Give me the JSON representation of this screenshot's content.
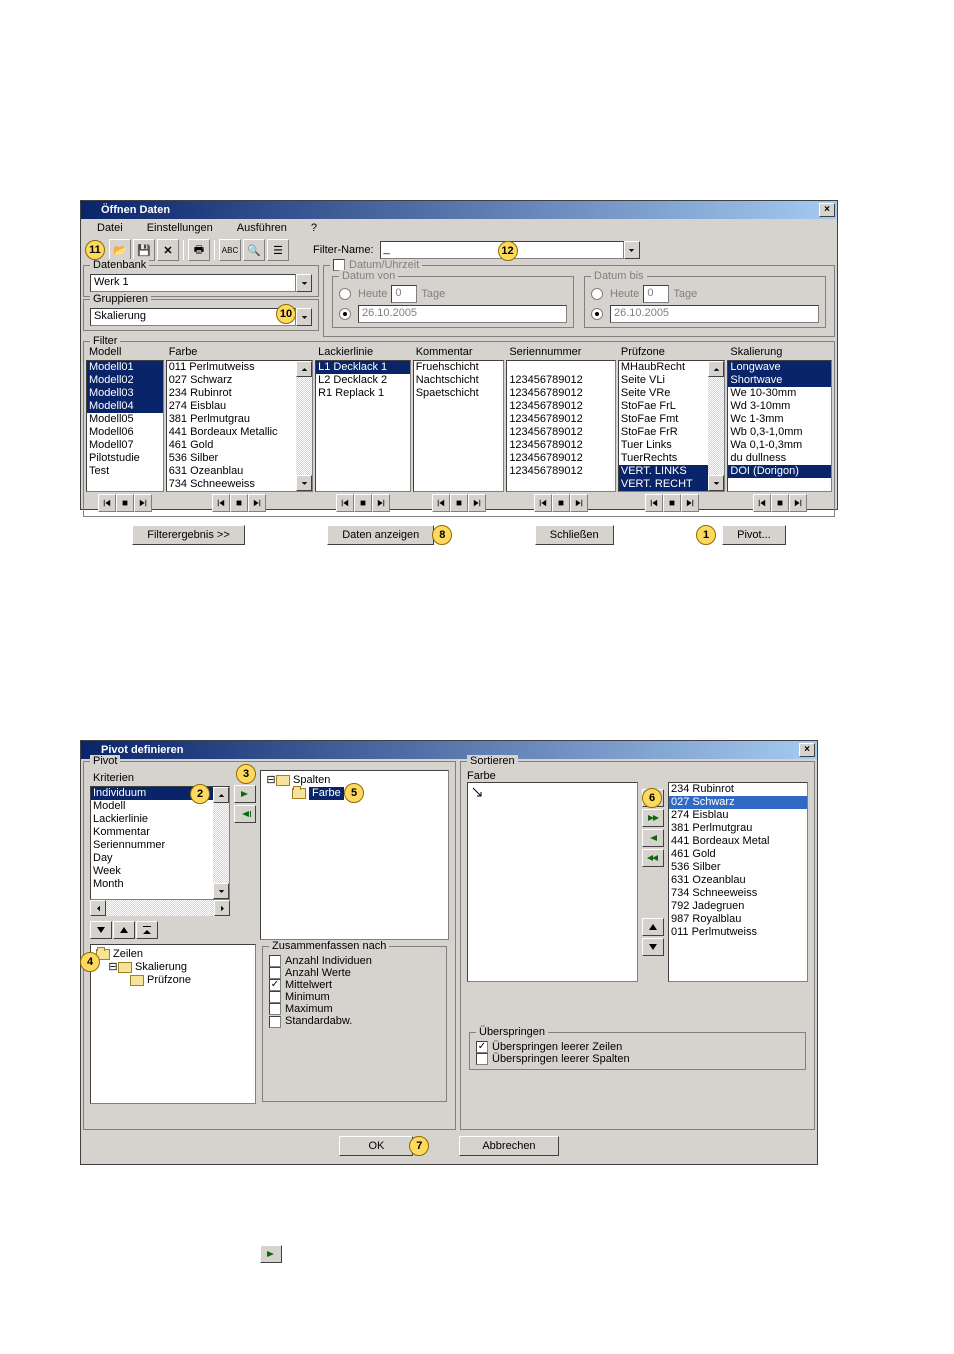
{
  "dialog1": {
    "title": "Öffnen Daten",
    "menu": {
      "m0": "Datei",
      "m1": "Einstellungen",
      "m2": "Ausführen",
      "m3": "?"
    },
    "toolbar": {
      "filtername_label": "Filter-Name:",
      "filtername_value": "_"
    },
    "datenbank": {
      "title": "Datenbank",
      "werk": "Werk 1"
    },
    "gruppieren": {
      "title": "Gruppieren",
      "field": "Skalierung"
    },
    "datumzeit": {
      "title": "Datum/Uhrzeit",
      "von": {
        "title": "Datum von",
        "r_heute": "Heute",
        "r_heute_val": "0",
        "tage": "Tage",
        "date": "26.10.2005"
      },
      "bis": {
        "title": "Datum bis",
        "r_heute": "Heute",
        "r_heute_val": "0",
        "tage": "Tage",
        "date": "26.10.2005"
      }
    },
    "filter": {
      "title": "Filter",
      "cols": {
        "modell": {
          "head": "Modell",
          "items": [
            "Modell01",
            "Modell02",
            "Modell03",
            "Modell04",
            "Modell05",
            "Modell06",
            "Modell07",
            "Pilotstudie",
            "Test"
          ],
          "sel": [
            0,
            1,
            2,
            3
          ]
        },
        "farbe": {
          "head": "Farbe",
          "items": [
            "011 Perlmutweiss",
            "027 Schwarz",
            "234 Rubinrot",
            "274 Eisblau",
            "381 Perlmutgrau",
            "441 Bordeaux Metallic",
            "461 Gold",
            "536 Silber",
            "631 Ozeanblau",
            "734 Schneeweiss"
          ],
          "sel": []
        },
        "lackierlinie": {
          "head": "Lackierlinie",
          "items": [
            "L1 Decklack 1",
            "L2 Decklack 2",
            "R1 Replack 1"
          ],
          "sel": [
            0
          ]
        },
        "kommentar": {
          "head": "Kommentar",
          "items": [
            "Fruehschicht",
            "Nachtschicht",
            "Spaetschicht"
          ],
          "sel": []
        },
        "seriennummer": {
          "head": "Seriennummer",
          "items": [
            "",
            "123456789012",
            "123456789012",
            "123456789012",
            "123456789012",
            "123456789012",
            "123456789012",
            "123456789012",
            "123456789012"
          ],
          "sel": []
        },
        "prufzone": {
          "head": "Prüfzone",
          "items": [
            "MHaubRecht",
            "Seite VLi",
            "Seite VRe",
            "StoFae FrL",
            "StoFae Fmt",
            "StoFae FrR",
            "Tuer Links",
            "TuerRechts",
            "VERT. LINKS",
            "VERT. RECHT"
          ],
          "sel": [
            8,
            9
          ]
        },
        "skalierung": {
          "head": "Skalierung",
          "items": [
            "Longwave",
            "Shortwave",
            "We 10-30mm",
            "Wd 3-10mm",
            "Wc 1-3mm",
            "Wb 0,3-1,0mm",
            "Wa 0,1-0,3mm",
            "du dullness",
            "DOI (Dorigon)"
          ],
          "sel": [
            0,
            1,
            8
          ]
        }
      }
    },
    "buttons": {
      "filterergebnis": "Filterergebnis >>",
      "daten_anzeigen": "Daten anzeigen",
      "schliessen": "Schließen",
      "pivot": "Pivot..."
    },
    "callouts": {
      "c11": "11",
      "c10": "10",
      "c12": "12",
      "c8": "8",
      "c1": "1"
    }
  },
  "dialog2": {
    "title": "Pivot definieren",
    "pivot": {
      "title": "Pivot"
    },
    "kriterien": {
      "title": "Kriterien",
      "items": [
        "Individuum",
        "Modell",
        "Lackierlinie",
        "Kommentar",
        "Seriennummer",
        "Day",
        "Week",
        "Month"
      ],
      "sel": [
        0
      ]
    },
    "zeilen": {
      "root": "Zeilen",
      "n1": "Skalierung",
      "n2": "Prüfzone"
    },
    "spalten": {
      "root": "Spalten",
      "n1": "Farbe"
    },
    "zusammen": {
      "title": "Zusammenfassen nach",
      "o1": "Anzahl Individuen",
      "o2": "Anzahl Werte",
      "o3": "Mittelwert",
      "o4": "Minimum",
      "o5": "Maximum",
      "o6": "Standardabw."
    },
    "sortieren": {
      "title": "Sortieren",
      "column": "Farbe",
      "items": [
        "234 Rubinrot",
        "027 Schwarz",
        "274 Eisblau",
        "381 Perlmutgrau",
        "441 Bordeaux Metal",
        "461 Gold",
        "536 Silber",
        "631 Ozeanblau",
        "734 Schneeweiss",
        "792 Jadegruen",
        "987 Royalblau",
        "011 Perlmutweiss"
      ],
      "sel": [
        1
      ]
    },
    "ueberspringen": {
      "title": "Überspringen",
      "o1": "Überspringen leerer Zeilen",
      "o2": "Überspringen leerer Spalten"
    },
    "ok": "OK",
    "abbrechen": "Abbrechen",
    "callouts": {
      "c3": "3",
      "c2": "2",
      "c5": "5",
      "c4": "4",
      "c6": "6",
      "c7": "7"
    }
  }
}
